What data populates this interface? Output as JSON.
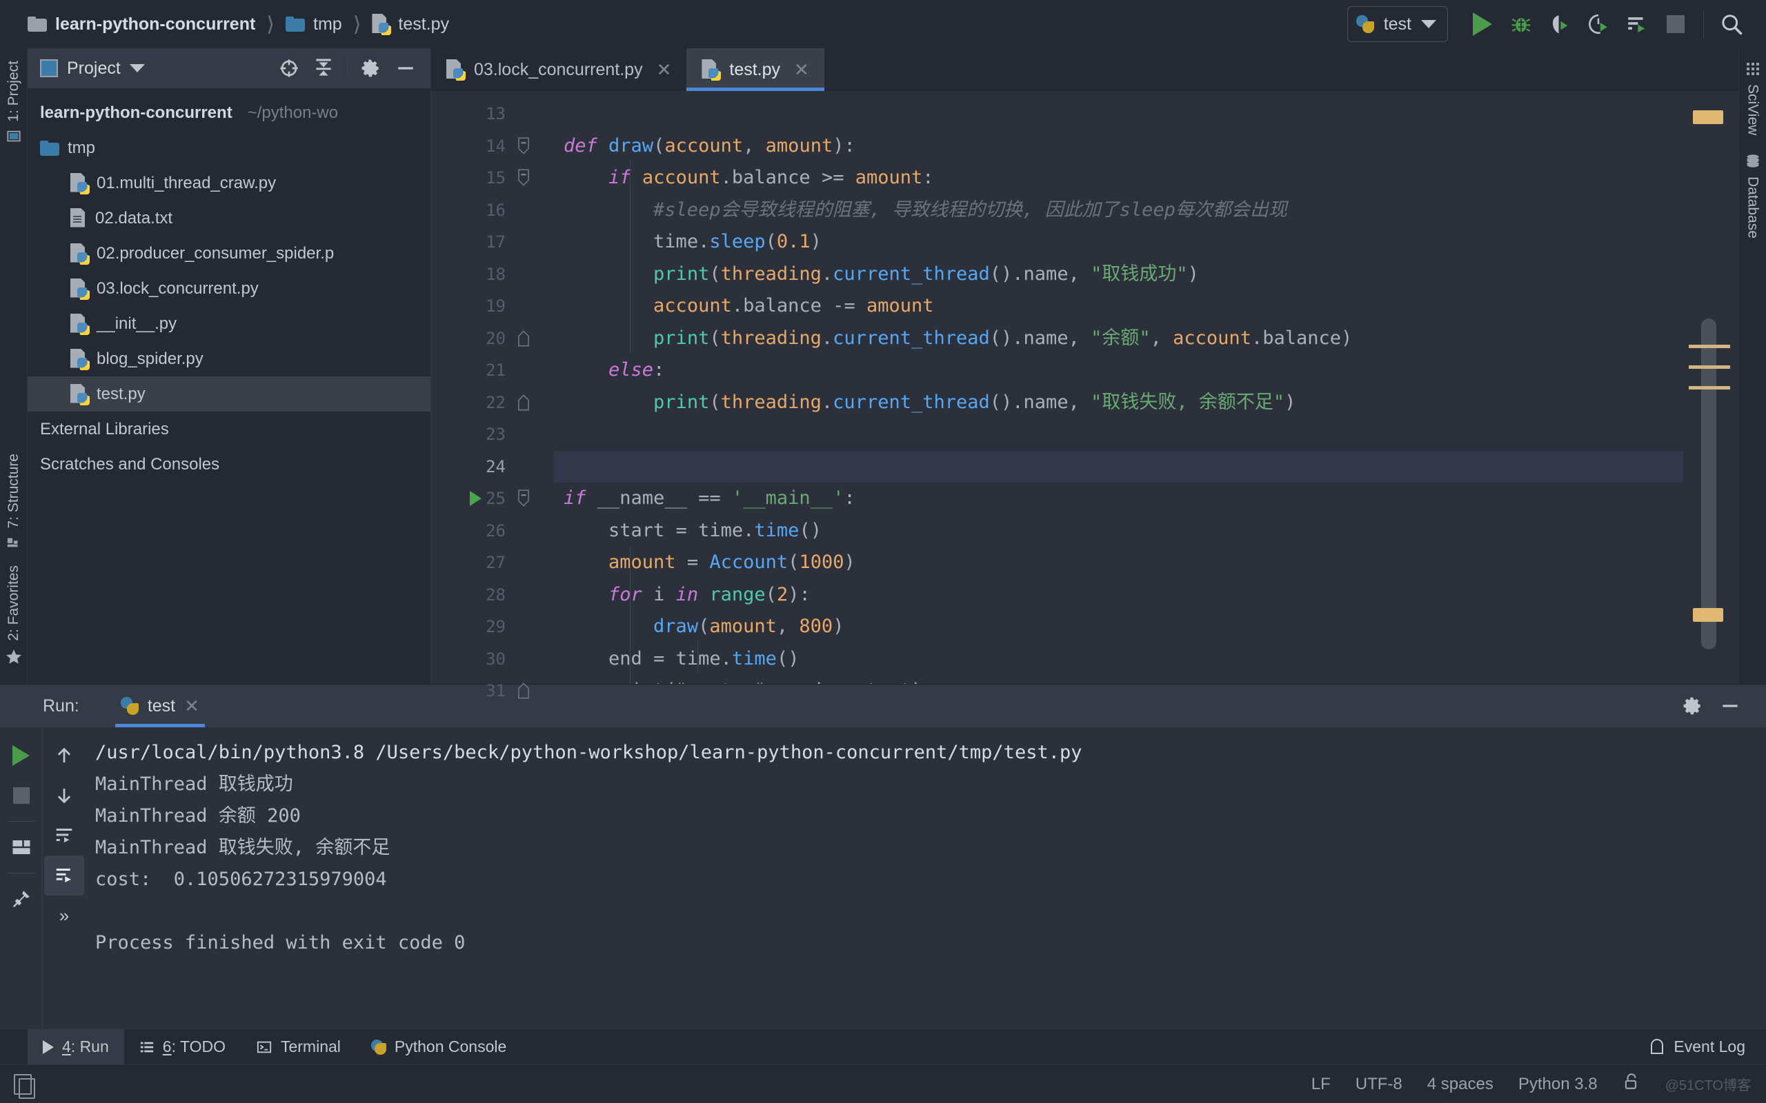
{
  "breadcrumb": [
    {
      "label": "learn-python-concurrent",
      "icon": "folder-icon"
    },
    {
      "label": "tmp",
      "icon": "folder-icon"
    },
    {
      "label": "test.py",
      "icon": "python-file-icon"
    }
  ],
  "toolbar": {
    "run_config": "test",
    "run_label": "Run",
    "debug_label": "Debug",
    "coverage_label": "Run with Coverage",
    "profile_label": "Profile",
    "concurrency_label": "Concurrency Diagram",
    "stop_label": "Stop",
    "search_label": "Search Everywhere"
  },
  "project_panel": {
    "title": "Project",
    "locate_label": "Select Opened File",
    "collapse_label": "Collapse All",
    "settings_label": "Settings",
    "hide_label": "Hide",
    "tree": [
      {
        "label": "learn-python-concurrent",
        "path": "~/python-wo",
        "kind": "root",
        "indent": 0,
        "selected": false
      },
      {
        "label": "tmp",
        "path": "",
        "kind": "folder",
        "indent": 1,
        "selected": false
      },
      {
        "label": "01.multi_thread_craw.py",
        "path": "",
        "kind": "python",
        "indent": 2,
        "selected": false
      },
      {
        "label": "02.data.txt",
        "path": "",
        "kind": "text",
        "indent": 2,
        "selected": false
      },
      {
        "label": "02.producer_consumer_spider.p",
        "path": "",
        "kind": "python",
        "indent": 2,
        "selected": false
      },
      {
        "label": "03.lock_concurrent.py",
        "path": "",
        "kind": "python",
        "indent": 2,
        "selected": false
      },
      {
        "label": "__init__.py",
        "path": "",
        "kind": "python",
        "indent": 2,
        "selected": false
      },
      {
        "label": "blog_spider.py",
        "path": "",
        "kind": "python",
        "indent": 2,
        "selected": false
      },
      {
        "label": "test.py",
        "path": "",
        "kind": "python",
        "indent": 2,
        "selected": true
      },
      {
        "label": "External Libraries",
        "path": "",
        "kind": "plain",
        "indent": 0,
        "selected": false
      },
      {
        "label": "Scratches and Consoles",
        "path": "",
        "kind": "plain",
        "indent": 0,
        "selected": false
      }
    ]
  },
  "editor": {
    "tabs": [
      {
        "label": "03.lock_concurrent.py",
        "active": false
      },
      {
        "label": "test.py",
        "active": true
      }
    ],
    "first_line": 13,
    "current_line": 24,
    "lines": [
      {
        "n": 13,
        "text": ""
      },
      {
        "n": 14,
        "text": "def draw(account, amount):"
      },
      {
        "n": 15,
        "text": "    if account.balance >= amount:"
      },
      {
        "n": 16,
        "text": "        #sleep会导致线程的阻塞, 导致线程的切换, 因此加了sleep每次都会出现"
      },
      {
        "n": 17,
        "text": "        time.sleep(0.1)"
      },
      {
        "n": 18,
        "text": "        print(threading.current_thread().name, \"取钱成功\")"
      },
      {
        "n": 19,
        "text": "        account.balance -= amount"
      },
      {
        "n": 20,
        "text": "        print(threading.current_thread().name, \"余额\", account.balance)"
      },
      {
        "n": 21,
        "text": "    else:"
      },
      {
        "n": 22,
        "text": "        print(threading.current_thread().name, \"取钱失败, 余额不足\")"
      },
      {
        "n": 23,
        "text": ""
      },
      {
        "n": 24,
        "text": ""
      },
      {
        "n": 25,
        "text": "if __name__ == '__main__':"
      },
      {
        "n": 26,
        "text": "    start = time.time()"
      },
      {
        "n": 27,
        "text": "    amount = Account(1000)"
      },
      {
        "n": 28,
        "text": "    for i in range(2):"
      },
      {
        "n": 29,
        "text": "        draw(amount, 800)"
      },
      {
        "n": 30,
        "text": "    end = time.time()"
      },
      {
        "n": 31,
        "text": "    print(\"cost: \", end - start)"
      }
    ]
  },
  "run_panel": {
    "label": "Run:",
    "tab": "test",
    "rerun_label": "Rerun",
    "stop_label": "Stop",
    "console_lines": [
      "/usr/local/bin/python3.8 /Users/beck/python-workshop/learn-python-concurrent/tmp/test.py",
      "MainThread 取钱成功",
      "MainThread 余额 200",
      "MainThread 取钱失败, 余额不足",
      "cost:  0.10506272315979004",
      "",
      "Process finished with exit code 0"
    ]
  },
  "left_rail": [
    {
      "label": "1: Project",
      "icon": "project-icon"
    },
    {
      "label": "7: Structure",
      "icon": "structure-icon"
    },
    {
      "label": "2: Favorites",
      "icon": "star-icon"
    }
  ],
  "right_rail": [
    {
      "label": "SciView",
      "icon": "grid-icon"
    },
    {
      "label": "Database",
      "icon": "database-icon"
    }
  ],
  "bottom_tabs": [
    {
      "num": "4",
      "label": ": Run",
      "icon": "play-icon",
      "active": true
    },
    {
      "num": "6",
      "label": ": TODO",
      "icon": "list-icon",
      "active": false
    },
    {
      "num": "",
      "label": "Terminal",
      "icon": "terminal-icon",
      "active": false
    },
    {
      "num": "",
      "label": "Python Console",
      "icon": "python-icon",
      "active": false
    }
  ],
  "event_log": "Event Log",
  "status_bar": {
    "line_ending": "LF",
    "encoding": "UTF-8",
    "indent": "4 spaces",
    "interpreter": "Python 3.8",
    "watermark": "@51CTO博客"
  },
  "colors": {
    "accent_blue": "#4a88d6",
    "run_green": "#4a9c4a",
    "warning_marker": "#e0b873",
    "selection": "#3a4049"
  }
}
